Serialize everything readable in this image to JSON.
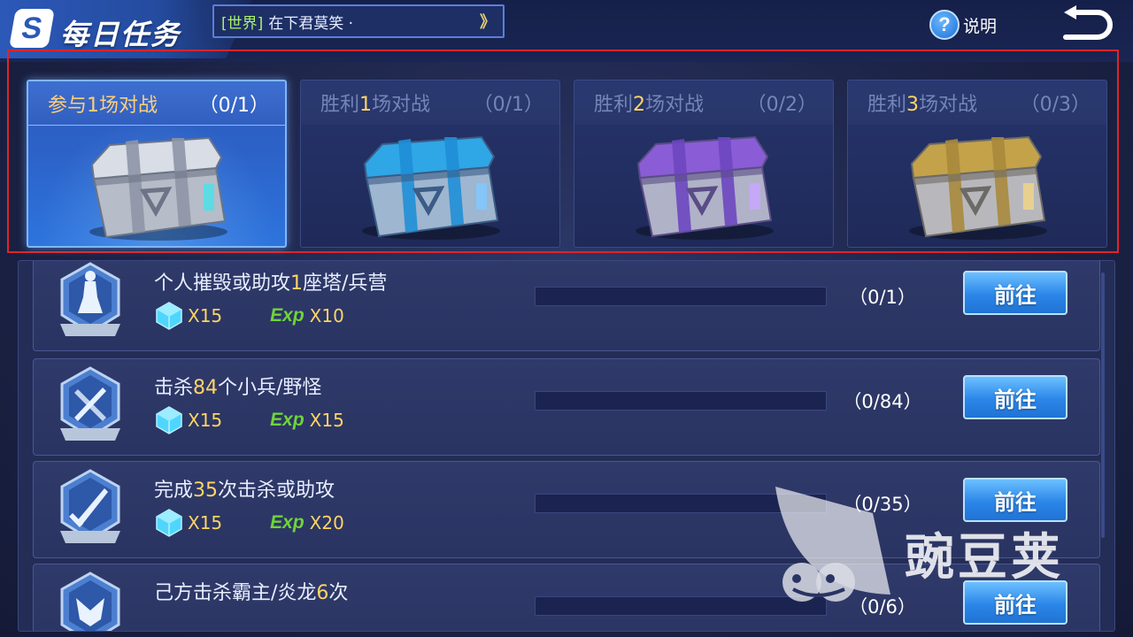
{
  "colors": {
    "accent": "#2d74dd",
    "highlight": "#ffd564",
    "exp_green": "#6fd43a",
    "frame_red": "#e0242a"
  },
  "header": {
    "logo": "S",
    "title": "每日任务",
    "chat": {
      "channel": "[世界]",
      "message": "在下君莫笑 ·",
      "arrow": "》"
    },
    "help": {
      "icon": "question-icon",
      "symbol": "?",
      "label": "说明"
    },
    "back": {
      "icon": "return-arrow-icon"
    }
  },
  "chests": [
    {
      "label_pre": "参与",
      "num": "1",
      "label_post": "场对战",
      "count": "（0/1）",
      "active": true,
      "color": "silver"
    },
    {
      "label_pre": "胜利",
      "num": "1",
      "label_post": "场对战",
      "count": "（0/1）",
      "active": false,
      "color": "blue"
    },
    {
      "label_pre": "胜利",
      "num": "2",
      "label_post": "场对战",
      "count": "（0/2）",
      "active": false,
      "color": "purple"
    },
    {
      "label_pre": "胜利",
      "num": "3",
      "label_post": "场对战",
      "count": "（0/3）",
      "active": false,
      "color": "gold"
    }
  ],
  "tasks": [
    {
      "pre": "个人摧毁或助攻",
      "num": "1",
      "post": "座塔/兵营",
      "gem": "X15",
      "exp_label": "Exp",
      "exp": "X10",
      "progress": "（0/1）",
      "progress_fraction": 0,
      "button": "前往",
      "icon": "tower-icon"
    },
    {
      "pre": "击杀",
      "num": "84",
      "post": "个小兵/野怪",
      "gem": "X15",
      "exp_label": "Exp",
      "exp": "X15",
      "progress": "（0/84）",
      "progress_fraction": 0,
      "button": "前往",
      "icon": "swords-icon"
    },
    {
      "pre": "完成",
      "num": "35",
      "post": "次击杀或助攻",
      "gem": "X15",
      "exp_label": "Exp",
      "exp": "X20",
      "progress": "（0/35）",
      "progress_fraction": 0,
      "button": "前往",
      "icon": "sword-icon"
    },
    {
      "pre": "己方击杀霸主/炎龙",
      "num": "6",
      "post": "次",
      "gem": "",
      "exp_label": "",
      "exp": "",
      "progress": "（0/6）",
      "progress_fraction": 0,
      "button": "前往",
      "icon": "dragon-icon"
    }
  ],
  "watermark": {
    "text": "豌豆荚"
  }
}
